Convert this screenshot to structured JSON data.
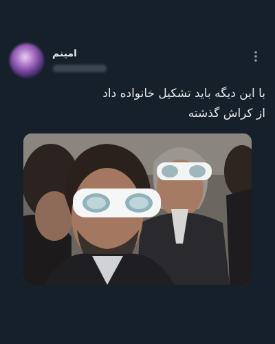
{
  "tweet": {
    "author": {
      "display_name": "امینم",
      "avatar_icon": "blurred-avatar"
    },
    "more_icon": "vertical-dots-icon",
    "text_lines": [
      "با این دیگه باید تشکیل خانواده داد",
      "از کراش گذشته"
    ],
    "media": {
      "type": "photo"
    }
  },
  "colors": {
    "background": "#15202b",
    "text": "#e7e9ea",
    "secondary": "#8b98a5"
  }
}
